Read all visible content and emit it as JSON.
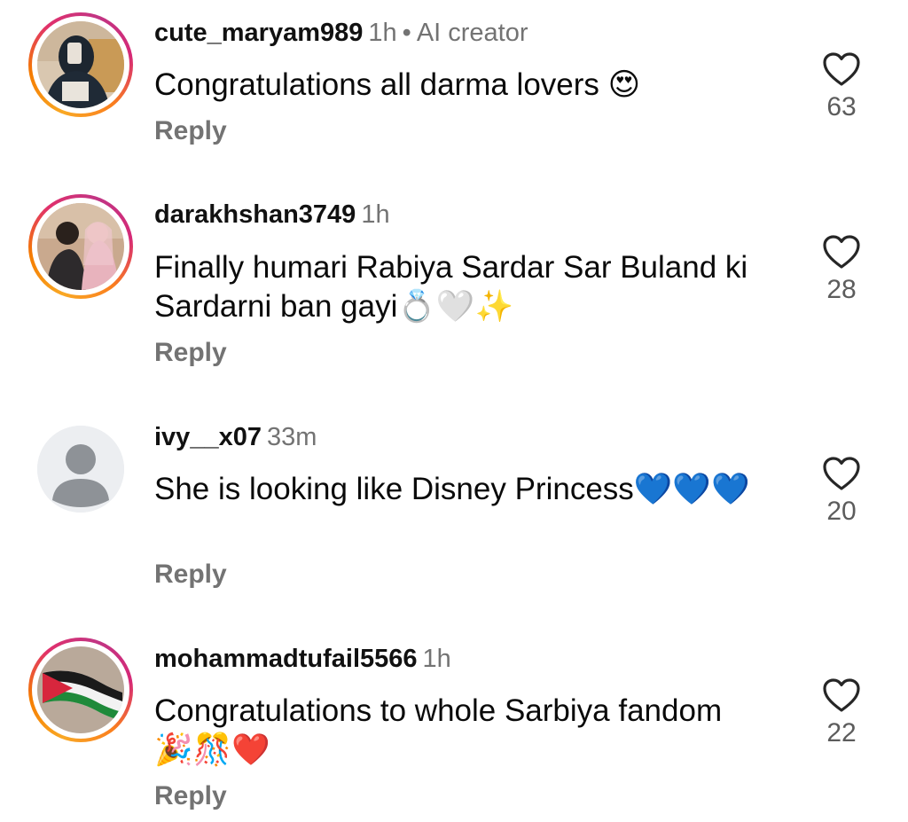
{
  "comments": [
    {
      "username": "cute_maryam989",
      "time": "1h",
      "separator": "•",
      "tag": "AI creator",
      "text": "Congratulations all darma lovers 😍",
      "reply_label": "Reply",
      "likes": "63",
      "avatar": "profile-photo-hijab-icon",
      "has_story_ring": true
    },
    {
      "username": "darakhshan3749",
      "time": "1h",
      "text": "Finally humari Rabiya Sardar Sar Buland ki Sardarni ban gayi💍🤍✨",
      "reply_label": "Reply",
      "likes": "28",
      "avatar": "profile-photo-couple-icon",
      "has_story_ring": true
    },
    {
      "username": "ivy__x07",
      "time": "33m",
      "text": "She is looking like Disney Princess💙💙💙",
      "reply_label": "Reply",
      "likes": "20",
      "avatar": "default-avatar-icon",
      "has_story_ring": false
    },
    {
      "username": "mohammadtufail5566",
      "time": "1h",
      "text": "Congratulations to whole Sarbiya fandom 🎉🎊❤️",
      "reply_label": "Reply",
      "likes": "22",
      "avatar": "palestine-flag-icon",
      "has_story_ring": true
    }
  ],
  "colors": {
    "text": "#0a0a0a",
    "secondary": "#737373",
    "like_icon": "#262626",
    "ring_start": "#f9a825",
    "ring_end": "#c13584"
  }
}
